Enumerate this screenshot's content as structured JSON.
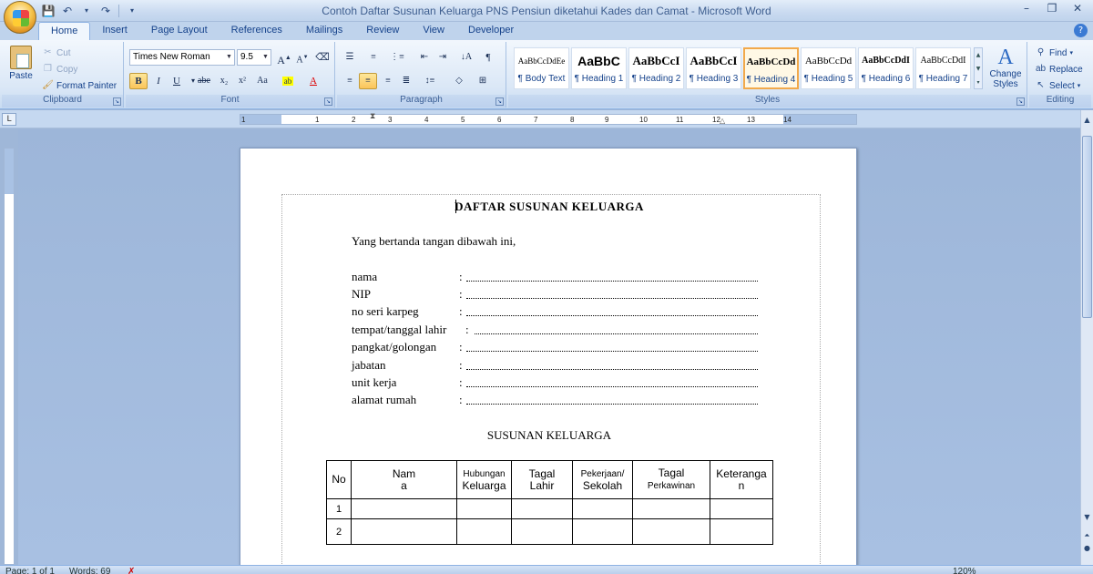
{
  "window": {
    "title": "Contoh Daftar Susunan Keluarga PNS Pensiun diketahui Kades dan Camat - Microsoft Word",
    "controls": {
      "minimize": "–",
      "restore": "❐",
      "close": "✕"
    }
  },
  "tabs": [
    "Home",
    "Insert",
    "Page Layout",
    "References",
    "Mailings",
    "Review",
    "View",
    "Developer"
  ],
  "clipboard": {
    "group_label": "Clipboard",
    "paste": "Paste",
    "cut": "Cut",
    "copy": "Copy",
    "format_painter": "Format Painter"
  },
  "font": {
    "group_label": "Font",
    "family": "Times New Roman",
    "size": "9.5",
    "buttons": {
      "bold": "B",
      "italic": "I",
      "underline": "U",
      "strike": "abe",
      "subscript": "x₂",
      "superscript": "x²",
      "change_case": "Aa",
      "grow": "A",
      "shrink": "A"
    }
  },
  "paragraph": {
    "group_label": "Paragraph"
  },
  "styles": {
    "group_label": "Styles",
    "items": [
      {
        "preview": "AaBbCcDdEe",
        "name": "¶ Body Text"
      },
      {
        "preview": "AaBbC",
        "name": "¶ Heading 1"
      },
      {
        "preview": "AaBbCcI",
        "name": "¶ Heading 2"
      },
      {
        "preview": "AaBbCcI",
        "name": "¶ Heading 3"
      },
      {
        "preview": "AaBbCcDd",
        "name": "¶ Heading 4"
      },
      {
        "preview": "AaBbCcDd",
        "name": "¶ Heading 5"
      },
      {
        "preview": "AaBbCcDdI",
        "name": "¶ Heading 6"
      },
      {
        "preview": "AaBbCcDdI",
        "name": "¶ Heading 7"
      }
    ],
    "selected": "¶ Heading 4",
    "change_styles": "Change Styles"
  },
  "editing": {
    "group_label": "Editing",
    "find": "Find",
    "replace": "Replace",
    "select": "Select"
  },
  "ruler": {
    "numbers": [
      "1",
      "1",
      "2",
      "3",
      "4",
      "5",
      "6",
      "7",
      "8",
      "9",
      "10",
      "11",
      "12",
      "13",
      "14"
    ]
  },
  "document": {
    "title": "DAFTAR  SUSUNAN  KELUARGA",
    "intro": "Yang bertanda tangan dibawah ini,",
    "fields": [
      {
        "label": "nama",
        "colon": ":"
      },
      {
        "label": "NIP",
        "colon": ":"
      },
      {
        "label": "no seri karpeg",
        "colon": ":"
      },
      {
        "label": "tempat/tanggal lahir",
        "colon": ":"
      },
      {
        "label": "pangkat/golongan",
        "colon": ":"
      },
      {
        "label": "jabatan",
        "colon": ":"
      },
      {
        "label": "unit kerja",
        "colon": ":"
      },
      {
        "label": "alamat rumah",
        "colon": ":"
      }
    ],
    "section_title": "SUSUNAN KELUARGA",
    "table": {
      "headers": [
        {
          "line1": "No",
          "line2": ""
        },
        {
          "line1": "Nam",
          "line2": "a"
        },
        {
          "line1": "Hubungan",
          "line2": "Keluarga"
        },
        {
          "line1": "Tagal",
          "line2": "Lahir"
        },
        {
          "line1": "Pekerjaan/",
          "line2": "Sekolah"
        },
        {
          "line1": "Tagal",
          "line2": "Perkawinan"
        },
        {
          "line1": "Keterangа",
          "line2": "n"
        }
      ],
      "rows": [
        [
          "1",
          "",
          "",
          "",
          "",
          "",
          ""
        ],
        [
          "2",
          "",
          "",
          "",
          "",
          "",
          ""
        ]
      ]
    }
  },
  "status": {
    "page": "Page: 1 of 1",
    "words": "Words: 69",
    "zoom": "120%"
  }
}
